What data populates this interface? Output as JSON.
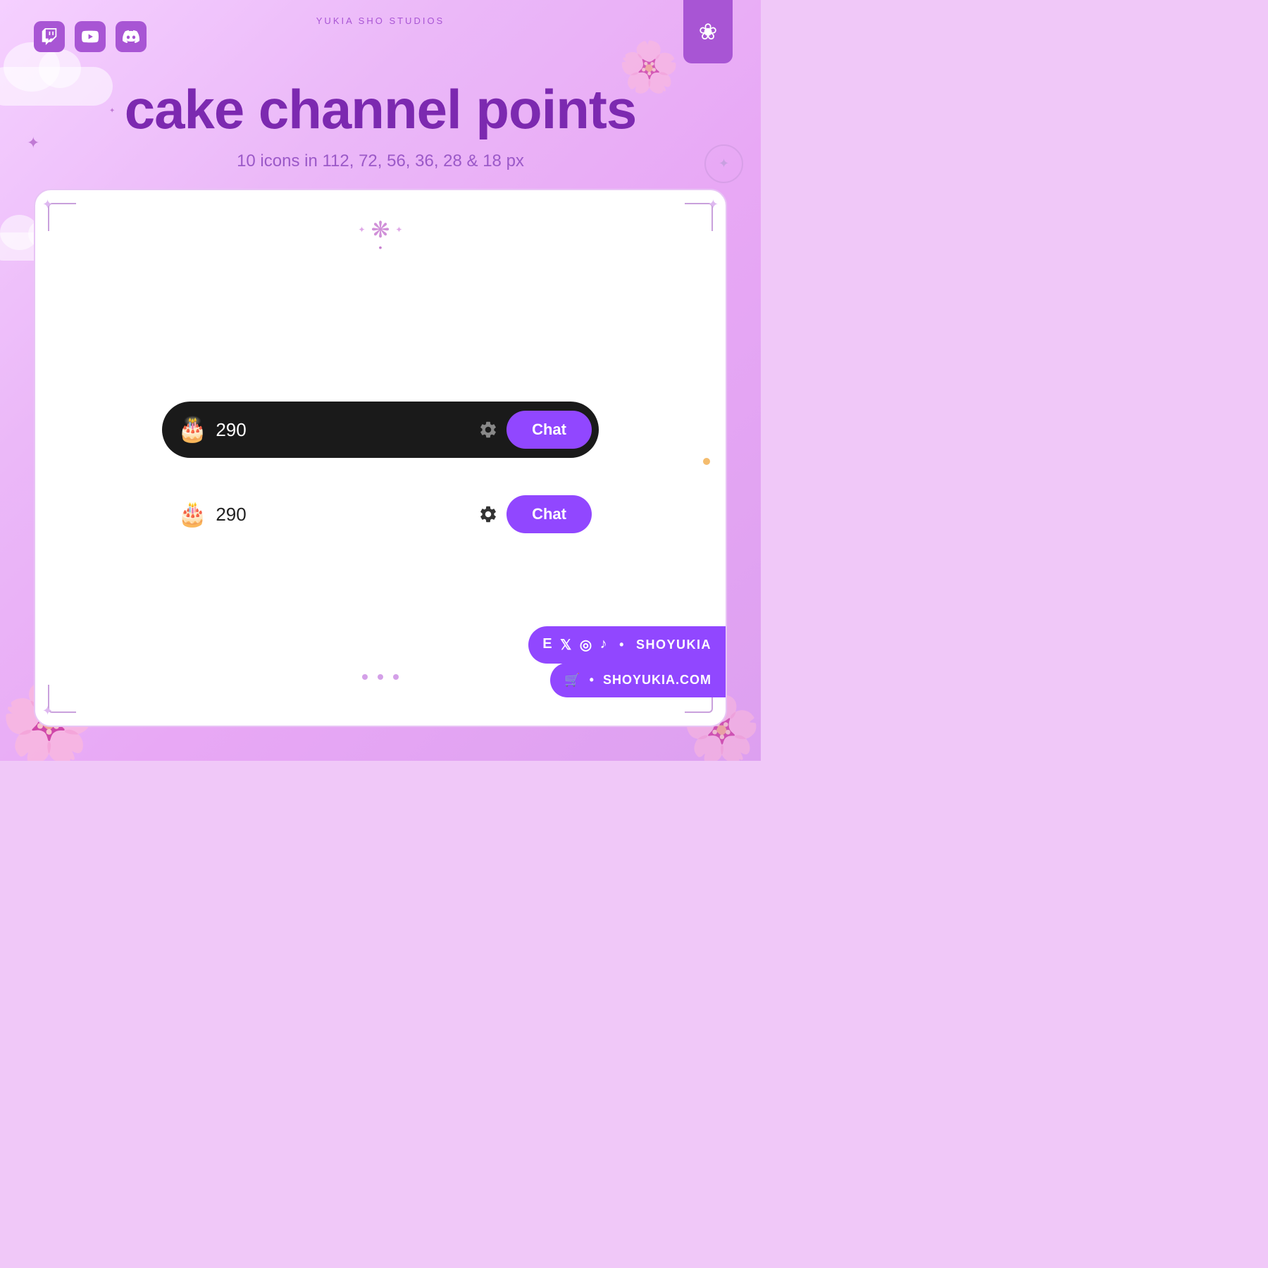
{
  "brand": {
    "studio_name": "YUKIA SHO STUDIOS",
    "title": "cake channel points",
    "subtitle": "10 icons in 112, 72, 56, 36, 28 & 18 px"
  },
  "social": {
    "handle": "SHOYUKIA",
    "website": "SHOYUKIA.COM"
  },
  "demo": {
    "points": "290",
    "chat_label": "Chat",
    "chat_label_2": "Chat"
  },
  "icons": {
    "twitch": "𝕿",
    "flower_badge": "❀",
    "sparkle": "✦",
    "sakura": "✿",
    "gear": "⚙",
    "cart": "🛒",
    "separator": "•"
  },
  "colors": {
    "purple_accent": "#9147ff",
    "purple_text": "#7c29b0",
    "purple_light": "#c48ae0",
    "bg_gradient_start": "#f5d0ff",
    "bg_gradient_end": "#dda0f0",
    "dark_bar": "#1a1a1a",
    "white": "#ffffff"
  }
}
